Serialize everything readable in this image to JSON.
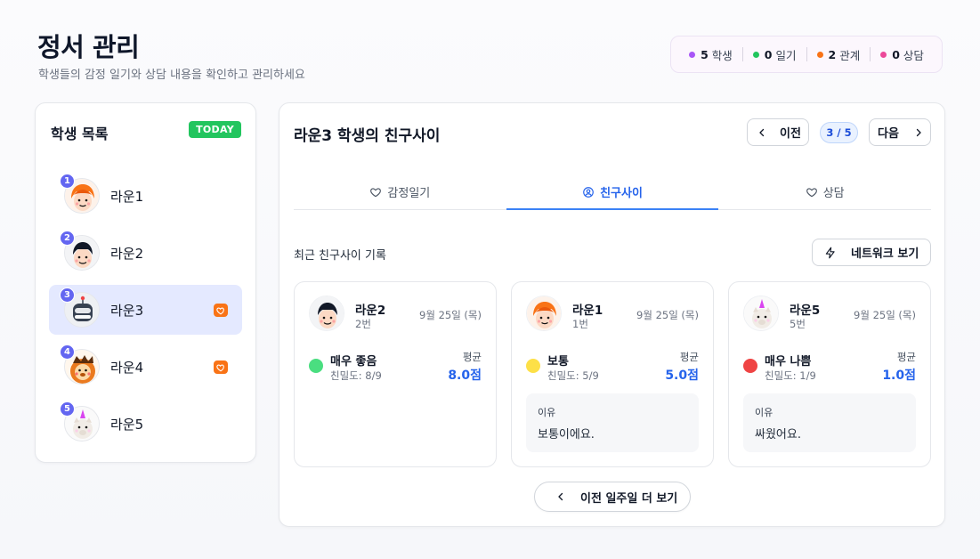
{
  "header": {
    "title": "정서 관리",
    "subtitle": "학생들의 감정 일기와 상담 내용을 확인하고 관리하세요"
  },
  "stats": [
    {
      "num": "5",
      "label": "학생",
      "color": "#a855f7"
    },
    {
      "num": "0",
      "label": "일기",
      "color": "#22c55e"
    },
    {
      "num": "2",
      "label": "관계",
      "color": "#f97316"
    },
    {
      "num": "0",
      "label": "상담",
      "color": "#ec4899"
    }
  ],
  "sidebar": {
    "title": "학생 목록",
    "badge": "TODAY",
    "students": [
      {
        "num": "1",
        "name": "라운1",
        "avatar": "redhair-avatar",
        "active": false,
        "alert": false
      },
      {
        "num": "2",
        "name": "라운2",
        "avatar": "blackhair-avatar",
        "active": false,
        "alert": false
      },
      {
        "num": "3",
        "name": "라운3",
        "avatar": "robot-avatar",
        "active": true,
        "alert": true
      },
      {
        "num": "4",
        "name": "라운4",
        "avatar": "lion-avatar",
        "active": false,
        "alert": true
      },
      {
        "num": "5",
        "name": "라운5",
        "avatar": "unicorn-avatar",
        "active": false,
        "alert": false
      }
    ]
  },
  "main": {
    "title": "라운3 학생의 친구사이",
    "prev_label": "이전",
    "next_label": "다음",
    "page_indicator": "3 / 5",
    "tabs": [
      {
        "label": "감정일기",
        "icon": "heart-outline-icon",
        "active": false
      },
      {
        "label": "친구사이",
        "icon": "user-circle-icon",
        "active": true
      },
      {
        "label": "상담",
        "icon": "heart-outline-icon",
        "active": false
      }
    ],
    "section_label": "최근 친구사이 기록",
    "network_label": "네트워크 보기",
    "more_label": "이전 일주일 더 보기"
  },
  "cards": [
    {
      "name": "라운2",
      "num": "2번",
      "date": "9월 25일 (목)",
      "mood": "매우 좋음",
      "mood_color": "#4ade80",
      "closeness": "친밀도: 8/9",
      "avg_label": "평균",
      "avg": "8.0점",
      "reason_label": "",
      "reason": "",
      "avatar": "blackhair-avatar"
    },
    {
      "name": "라운1",
      "num": "1번",
      "date": "9월 25일 (목)",
      "mood": "보통",
      "mood_color": "#fde047",
      "closeness": "친밀도: 5/9",
      "avg_label": "평균",
      "avg": "5.0점",
      "reason_label": "이유",
      "reason": "보통이에요.",
      "avatar": "redhair-avatar"
    },
    {
      "name": "라운5",
      "num": "5번",
      "date": "9월 25일 (목)",
      "mood": "매우 나쁨",
      "mood_color": "#ef4444",
      "closeness": "친밀도: 1/9",
      "avg_label": "평균",
      "avg": "1.0점",
      "reason_label": "이유",
      "reason": "싸웠어요.",
      "avatar": "unicorn-avatar"
    }
  ]
}
